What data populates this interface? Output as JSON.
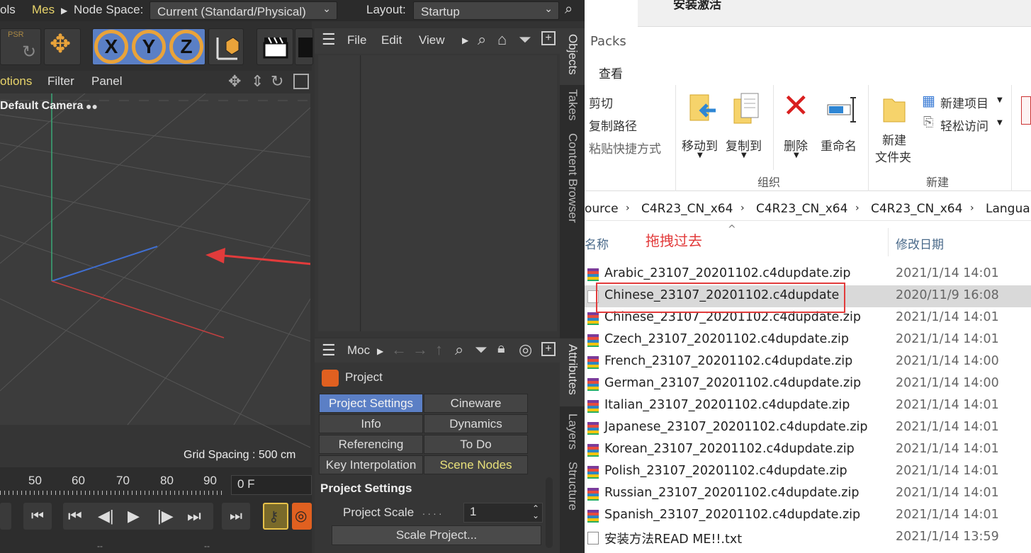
{
  "c4d": {
    "menubar": {
      "tools": "ols",
      "mesh": "Mes",
      "node_space_label": "Node Space:",
      "node_space_value": "Current (Standard/Physical)",
      "layout_label": "Layout:",
      "layout_value": "Startup"
    },
    "toolbar": {
      "x": "X",
      "y": "Y",
      "z": "Z",
      "psr": "PSR"
    },
    "viewport_menu": {
      "options": "otions",
      "filter": "Filter",
      "panel": "Panel"
    },
    "viewport": {
      "camera": "Default Camera",
      "grid_spacing": "Grid Spacing : 500 cm"
    },
    "timeline": {
      "ticks": [
        "50",
        "60",
        "70",
        "80",
        "90"
      ],
      "frame": "0 F",
      "marks": [
        "--",
        "--"
      ]
    },
    "objects_menu": {
      "file": "File",
      "edit": "Edit",
      "view": "View"
    },
    "side_tabs": {
      "objects": "Objects",
      "takes": "Takes",
      "content_browser": "Content Browser",
      "attributes": "Attributes",
      "layers": "Layers",
      "structure": "Structure"
    },
    "attributes": {
      "mode": "Moc",
      "object": "Project",
      "tabs": [
        {
          "label": "Project Settings",
          "state": "active"
        },
        {
          "label": "Cineware",
          "state": ""
        },
        {
          "label": "Info",
          "state": ""
        },
        {
          "label": "Dynamics",
          "state": ""
        },
        {
          "label": "Referencing",
          "state": ""
        },
        {
          "label": "To Do",
          "state": ""
        },
        {
          "label": "Key Interpolation",
          "state": ""
        },
        {
          "label": "Scene Nodes",
          "state": "highlight"
        }
      ],
      "section_title": "Project Settings",
      "scale_label": "Project Scale",
      "scale_dots": ". . . .",
      "scale_value": "1",
      "scale_button": "Scale Project..."
    }
  },
  "explorer": {
    "top_title": "安装激活",
    "window_title": "Packs",
    "view_tab": "查看",
    "ribbon": {
      "cut": "剪切",
      "copy_path": "复制路径",
      "paste_shortcut": "粘贴快捷方式",
      "move_to": "移动到",
      "copy_to": "复制到",
      "delete": "删除",
      "rename": "重命名",
      "new_folder_1": "新建",
      "new_folder_2": "文件夹",
      "new_item": "新建项目",
      "easy_access": "轻松访问",
      "group_organize": "组织",
      "group_new": "新建"
    },
    "address": [
      "ource",
      "C4R23_CN_x64",
      "C4R23_CN_x64",
      "C4R23_CN_x64",
      "Langua"
    ],
    "columns": {
      "name": "名称",
      "date": "修改日期"
    },
    "annotation": "拖拽过去",
    "files": [
      {
        "name": "Arabic_23107_20201102.c4dupdate.zip",
        "date": "2021/1/14 14:01",
        "type": "zip"
      },
      {
        "name": "Chinese_23107_20201102.c4dupdate",
        "date": "2020/11/9 16:08",
        "type": "folder"
      },
      {
        "name": "Chinese_23107_20201102.c4dupdate.zip",
        "date": "2021/1/14 14:01",
        "type": "zip"
      },
      {
        "name": "Czech_23107_20201102.c4dupdate.zip",
        "date": "2021/1/14 14:01",
        "type": "zip"
      },
      {
        "name": "French_23107_20201102.c4dupdate.zip",
        "date": "2021/1/14 14:00",
        "type": "zip"
      },
      {
        "name": "German_23107_20201102.c4dupdate.zip",
        "date": "2021/1/14 14:00",
        "type": "zip"
      },
      {
        "name": "Italian_23107_20201102.c4dupdate.zip",
        "date": "2021/1/14 14:01",
        "type": "zip"
      },
      {
        "name": "Japanese_23107_20201102.c4dupdate.zip",
        "date": "2021/1/14 14:01",
        "type": "zip"
      },
      {
        "name": "Korean_23107_20201102.c4dupdate.zip",
        "date": "2021/1/14 14:01",
        "type": "zip"
      },
      {
        "name": "Polish_23107_20201102.c4dupdate.zip",
        "date": "2021/1/14 14:01",
        "type": "zip"
      },
      {
        "name": "Russian_23107_20201102.c4dupdate.zip",
        "date": "2021/1/14 14:01",
        "type": "zip"
      },
      {
        "name": "Spanish_23107_20201102.c4dupdate.zip",
        "date": "2021/1/14 14:01",
        "type": "zip"
      },
      {
        "name": "安装方法READ ME!!.txt",
        "date": "2021/1/14 13:59",
        "type": "txt"
      }
    ]
  }
}
